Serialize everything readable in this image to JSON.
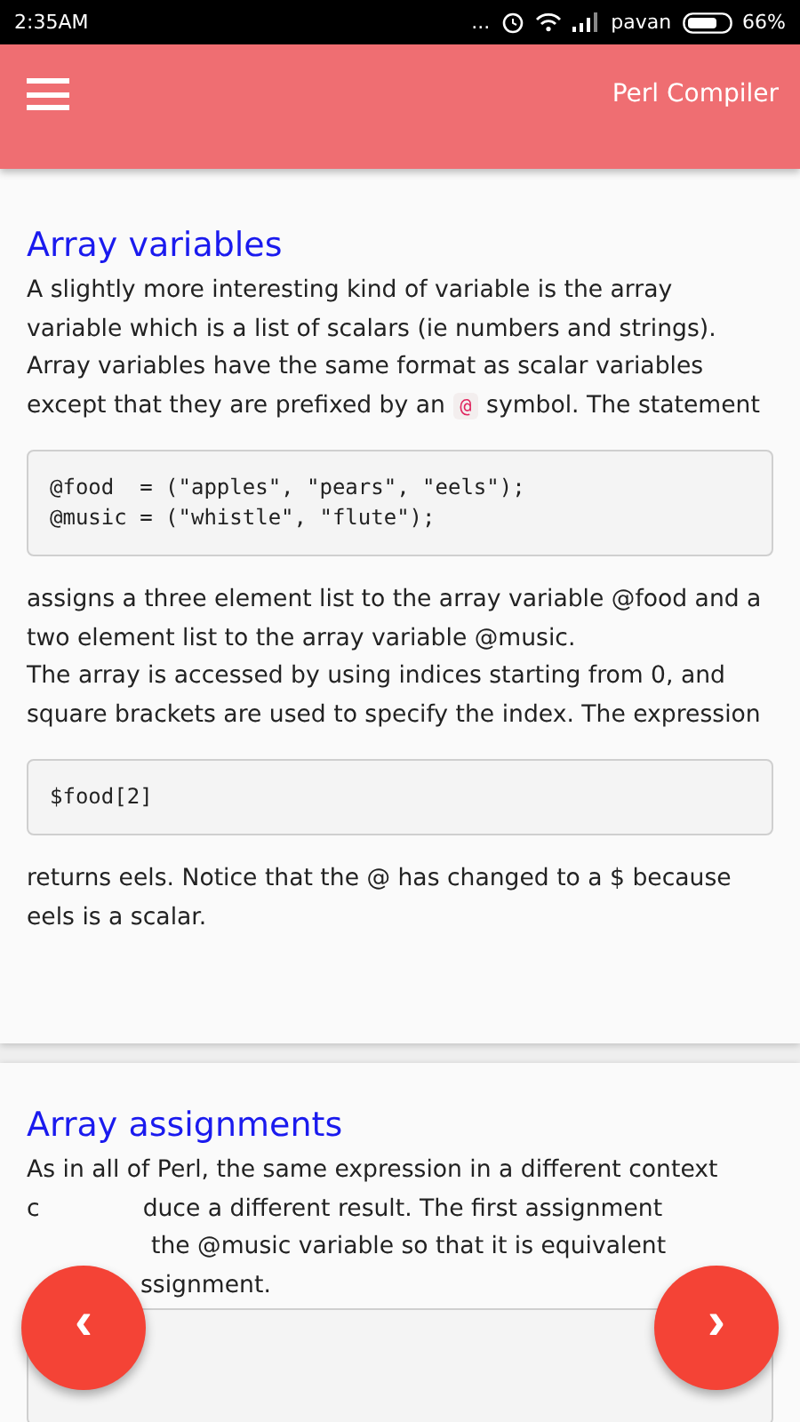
{
  "status_bar": {
    "time": "2:35AM",
    "dots": "...",
    "carrier": "pavan",
    "battery": "66%"
  },
  "app_bar": {
    "title": "Perl Compiler"
  },
  "sections": [
    {
      "title": "Array variables",
      "intro": {
        "before": "A slightly more interesting kind of variable is the array variable which is a list of scalars (ie numbers and strings). Array variables have the same format as scalar variables except that they are prefixed by an",
        "code": "@",
        "after": "symbol. The statement"
      },
      "blocks": [
        {
          "kind": "code",
          "lines": [
            "@food  = (\"apples\", \"pears\", \"eels\");",
            "@music = (\"whistle\", \"flute\");"
          ]
        },
        {
          "kind": "text",
          "text": "assigns a three element list to the array variable @food and a two element list to the array variable @music."
        },
        {
          "kind": "text",
          "text": "The array is accessed by using indices starting from 0, and square brackets are used to specify the index. The expression"
        },
        {
          "kind": "code",
          "lines": [
            "$food[2]"
          ]
        },
        {
          "kind": "text",
          "text": "returns eels. Notice that the @ has changed to a $ because eels is a scalar."
        }
      ]
    },
    {
      "title": "Array assignments",
      "lines": [
        {
          "kind": "full",
          "parts": [
            "As in all of Perl, the same expression in a different context"
          ]
        },
        {
          "kind": "split",
          "parts": [
            "c",
            "duce a different result. The first assignment"
          ]
        },
        {
          "kind": "tail",
          "parts": [
            "the @music variable so that it is equivalent"
          ]
        },
        {
          "kind": "tail",
          "parts": [
            "ssignment."
          ]
        }
      ]
    }
  ],
  "nav": {
    "previous": "‹",
    "next": "›"
  }
}
